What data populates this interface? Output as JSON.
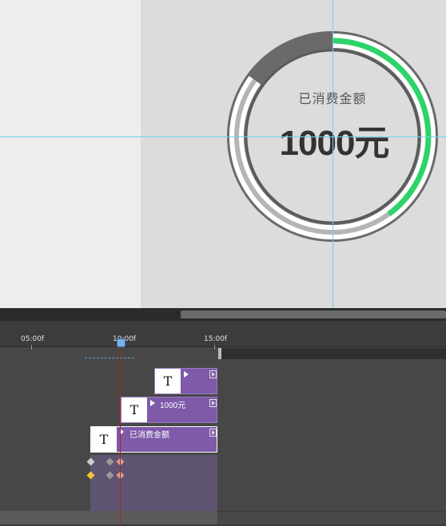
{
  "colors": {
    "progress": "#2ed36a",
    "ring_gray": "#6a6a6a",
    "clip_purple": "#7e5aa9",
    "playhead": "#b02020",
    "guide": "#6fd0f0"
  },
  "canvas": {
    "ring_title": "已消费金额",
    "ring_value": "1000元",
    "progress_fraction": 0.4
  },
  "timeline": {
    "ruler_labels": [
      "05:00f",
      "10:00f",
      "15:00f"
    ],
    "playhead_time": "10:00f",
    "layers": [
      {
        "icon": "T",
        "label": ""
      },
      {
        "icon": "T",
        "label": "1000元"
      },
      {
        "icon": "T",
        "label": "已消费金额"
      }
    ]
  }
}
